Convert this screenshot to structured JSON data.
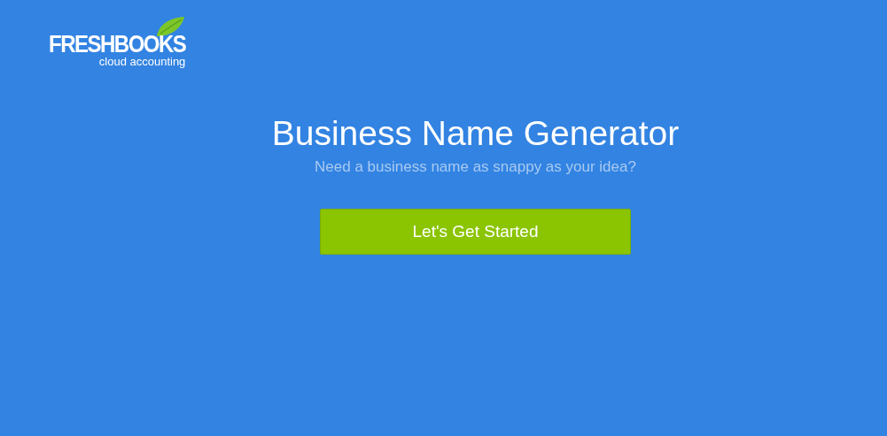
{
  "logo": {
    "wordmark": "FRESHBOOKS",
    "tagline": "cloud accounting"
  },
  "hero": {
    "title": "Business Name Generator",
    "subtitle": "Need a business name as snappy as your idea?"
  },
  "cta_button": {
    "label": "Let's Get Started"
  }
}
